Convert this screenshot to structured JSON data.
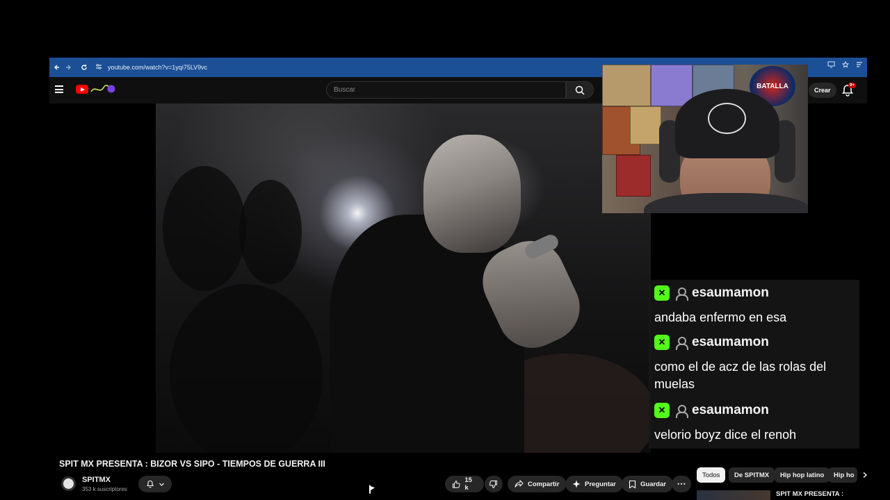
{
  "browser": {
    "url": "youtube.com/watch?v=1yqi75LV9vc"
  },
  "header": {
    "search_placeholder": "Buscar",
    "create_label": "Crear",
    "notifications_badge": "9+"
  },
  "webcam": {
    "poster_text": "BATALLA"
  },
  "chat": {
    "messages": [
      {
        "user": "esaumamon",
        "text": "andaba enfermo en esa"
      },
      {
        "user": "esaumamon",
        "text": "como el de acz de las rolas del muelas"
      },
      {
        "user": "esaumamon",
        "text": "velorio boyz dice el renoh"
      }
    ],
    "badge_glyph": "✕"
  },
  "video": {
    "title": "SPIT MX PRESENTA : BIZOR VS SIPO - TIEMPOS DE GUERRA III",
    "channel_name": "SPITMX",
    "subscribers": "353 k suscriptores",
    "likes": "15 k",
    "share_label": "Compartir",
    "ask_label": "Preguntar",
    "save_label": "Guardar",
    "more_glyph": "⋯"
  },
  "chips": [
    "Todos",
    "De SPITMX",
    "Hip hop latino",
    "Hip ho"
  ],
  "recommendation": {
    "title": "SPIT MX PRESENTA :"
  },
  "colors": {
    "browser_bar": "#1b4f96",
    "youtube_red": "#ff0000",
    "kick_green": "#53fc18"
  }
}
